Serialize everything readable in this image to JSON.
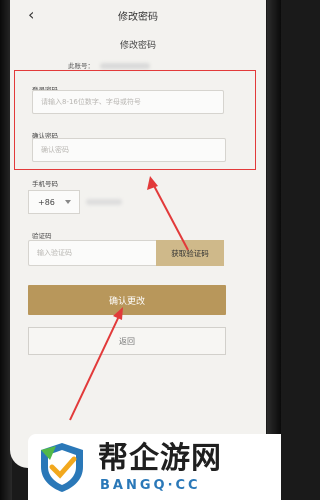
{
  "nav": {
    "title": "修改密码",
    "back_icon": "chevron-left-icon"
  },
  "form": {
    "subtitle": "修改密码",
    "account_label": "此账号：",
    "new_password": {
      "label": "登录密码",
      "placeholder": "请输入8-16位数字、字母或符号"
    },
    "confirm_password": {
      "label": "确认密码",
      "placeholder": "确认密码"
    },
    "phone": {
      "label": "手机号码",
      "country_code": "+86"
    },
    "code": {
      "label": "验证码",
      "placeholder": "输入验证码",
      "button": "获取验证码"
    },
    "submit": "确认更改",
    "back": "返回"
  },
  "watermark": {
    "title": "帮企游网",
    "subtitle": "BANGQ·CC"
  },
  "colors": {
    "highlight": "#e23a3a",
    "accent": "#b8975b",
    "code_button": "#cfb98a"
  }
}
